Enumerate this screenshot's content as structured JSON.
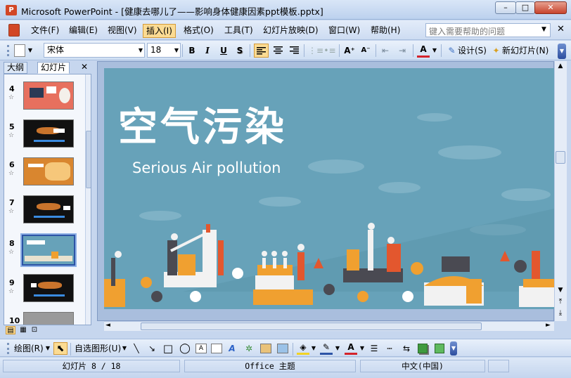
{
  "window": {
    "app_icon": "P",
    "title": "Microsoft PowerPoint - [健康去哪儿了——影响身体健康因素ppt模板.pptx]",
    "minimize": "–",
    "maximize": "□",
    "close": "✕"
  },
  "menu": {
    "items": [
      {
        "label": "文件(F)"
      },
      {
        "label": "编辑(E)"
      },
      {
        "label": "视图(V)"
      },
      {
        "label": "插入(I)"
      },
      {
        "label": "格式(O)"
      },
      {
        "label": "工具(T)"
      },
      {
        "label": "幻灯片放映(D)"
      },
      {
        "label": "窗口(W)"
      },
      {
        "label": "帮助(H)"
      }
    ],
    "help_placeholder": "键入需要帮助的问题",
    "help_drop": "▼",
    "doc_close": "✕"
  },
  "toolbar": {
    "font_name": "宋体",
    "font_size": "18",
    "bold": "B",
    "italic": "I",
    "underline": "U",
    "shadow": "S",
    "design_label": "设计(S)",
    "new_slide_label": "新幻灯片(N)",
    "increase_font": "A⁺",
    "decrease_font": "A⁻",
    "font_color_glyph": "A",
    "drop": "▼"
  },
  "pane": {
    "tab_outline": "大纲",
    "tab_slides": "幻灯片",
    "close": "✕",
    "star": "☆",
    "thumbnails": [
      {
        "number": "4",
        "bg": "#e7705e"
      },
      {
        "number": "5",
        "bg": "#111111"
      },
      {
        "number": "6",
        "bg": "#d9862f"
      },
      {
        "number": "7",
        "bg": "#111111"
      },
      {
        "number": "8",
        "bg": "#67a2b9"
      },
      {
        "number": "9",
        "bg": "#111111"
      },
      {
        "number": "10",
        "bg": "#9a9a9a"
      }
    ],
    "view_icons": [
      "▤",
      "▦",
      "⊡"
    ]
  },
  "slide": {
    "title": "空气污染",
    "subtitle": "Serious Air pollution",
    "bg_color": "#67a2b9",
    "accent_orange": "#f0a030",
    "accent_red": "#e3572e"
  },
  "scroll": {
    "up": "▲",
    "down": "▼",
    "left": "◄",
    "right": "►",
    "prev_slide": "⤒",
    "next_slide": "⤓"
  },
  "drawing": {
    "draw_label": "绘图(R)",
    "autoshape_label": "自选图形(U)",
    "pointer_icon": "⬉",
    "line_icon": "╲",
    "arrow_icon": "↘",
    "rect_icon": "□",
    "oval_icon": "◯",
    "textbox_icon": "A",
    "font_color": "A"
  },
  "status": {
    "slide_info": "幻灯片 8 / 18",
    "theme": "Office 主题",
    "language": "中文(中国)"
  }
}
